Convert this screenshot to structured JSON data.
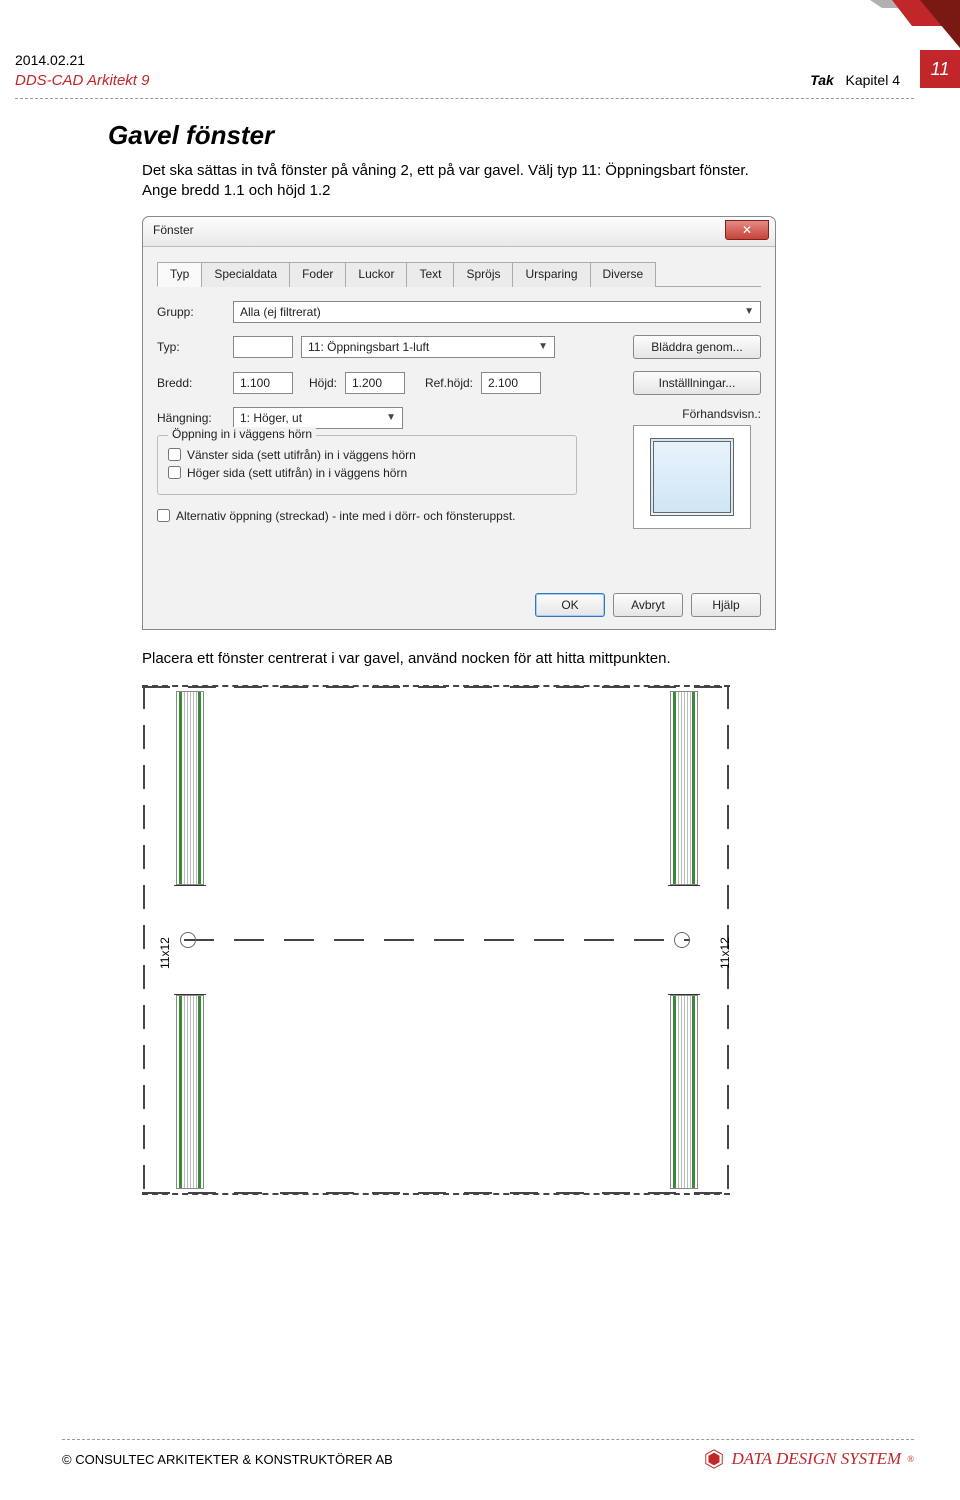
{
  "header": {
    "date": "2014.02.21",
    "product": "DDS-CAD Arkitekt 9",
    "section": "Tak",
    "chapter": "Kapitel 4",
    "pageNo": "11"
  },
  "content": {
    "title": "Gavel fönster",
    "intro1": "Det ska sättas in två fönster på våning 2, ett på var gavel. Välj typ 11: Öppningsbart fönster.",
    "intro2": "Ange bredd 1.1 och höjd 1.2",
    "afterText": "Placera ett fönster centrerat i var gavel, använd nocken för att hitta mittpunkten."
  },
  "dialog": {
    "title": "Fönster",
    "tabs": [
      "Typ",
      "Specialdata",
      "Foder",
      "Luckor",
      "Text",
      "Spröjs",
      "Ursparing",
      "Diverse"
    ],
    "labels": {
      "grupp": "Grupp:",
      "typ": "Typ:",
      "bredd": "Bredd:",
      "hojd": "Höjd:",
      "refhojd": "Ref.höjd:",
      "hangning": "Hängning:",
      "forhand": "Förhandsvisn.:"
    },
    "values": {
      "grupp": "Alla (ej filtrerat)",
      "typ": "11:  Öppningsbart 1-luft",
      "bredd": "1.100",
      "hojd": "1.200",
      "refhojd": "2.100",
      "hangning": "1: Höger, ut"
    },
    "buttons": {
      "bladdra": "Bläddra genom...",
      "installningar": "Inställlningar...",
      "ok": "OK",
      "avbryt": "Avbryt",
      "hjalp": "Hjälp"
    },
    "group": {
      "caption": "Öppning in i väggens hörn",
      "chk1": "Vänster sida (sett utifrån) in i väggens hörn",
      "chk2": "Höger sida (sett utifrån) in i väggens hörn",
      "chk3": "Alternativ öppning (streckad) - inte med i dörr- och fönsteruppst."
    }
  },
  "plan": {
    "dimLabel": "11x12"
  },
  "footer": {
    "copyright": "©  CONSULTEC ARKITEKTER & KONSTRUKTÖRER AB",
    "brand": "DATA DESIGN SYSTEM"
  }
}
